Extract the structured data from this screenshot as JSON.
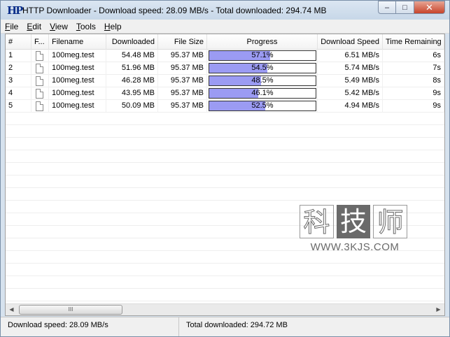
{
  "window": {
    "title": "HTTP Downloader - Download speed: 28.09 MB/s - Total downloaded: 294.74 MB",
    "icon": "HP",
    "buttons": {
      "minimize": "–",
      "maximize": "□",
      "close": "✕"
    }
  },
  "menu": [
    {
      "label": "File",
      "underline": "F",
      "rest": "ile"
    },
    {
      "label": "Edit",
      "underline": "E",
      "rest": "dit"
    },
    {
      "label": "View",
      "underline": "V",
      "rest": "iew"
    },
    {
      "label": "Tools",
      "underline": "T",
      "rest": "ools"
    },
    {
      "label": "Help",
      "underline": "H",
      "rest": "elp"
    }
  ],
  "columns": [
    "#",
    "F...",
    "Filename",
    "Downloaded",
    "File Size",
    "Progress",
    "Download Speed",
    "Time Remaining"
  ],
  "rows": [
    {
      "num": "1",
      "filename": "100meg.test",
      "downloaded": "54.48 MB",
      "size": "95.37 MB",
      "progress_label": "57.1%",
      "progress": 57.1,
      "speed": "6.51 MB/s",
      "remaining": "6s"
    },
    {
      "num": "2",
      "filename": "100meg.test",
      "downloaded": "51.96 MB",
      "size": "95.37 MB",
      "progress_label": "54.5%",
      "progress": 54.5,
      "speed": "5.74 MB/s",
      "remaining": "7s"
    },
    {
      "num": "3",
      "filename": "100meg.test",
      "downloaded": "46.28 MB",
      "size": "95.37 MB",
      "progress_label": "48.5%",
      "progress": 48.5,
      "speed": "5.49 MB/s",
      "remaining": "8s"
    },
    {
      "num": "4",
      "filename": "100meg.test",
      "downloaded": "43.95 MB",
      "size": "95.37 MB",
      "progress_label": "46.1%",
      "progress": 46.1,
      "speed": "5.42 MB/s",
      "remaining": "9s"
    },
    {
      "num": "5",
      "filename": "100meg.test",
      "downloaded": "50.09 MB",
      "size": "95.37 MB",
      "progress_label": "52.5%",
      "progress": 52.5,
      "speed": "4.94 MB/s",
      "remaining": "9s"
    }
  ],
  "scrollbar": {
    "left_arrow": "◀",
    "right_arrow": "▶",
    "grip": "III"
  },
  "status": {
    "speed": "Download speed: 28.09 MB/s",
    "total": "Total downloaded: 294.72 MB"
  },
  "watermark": {
    "chars": [
      "科",
      "技",
      "师"
    ],
    "url": "WWW.3KJS.COM"
  },
  "colors": {
    "progress_fill": "#9b9bf3",
    "title_gradient": "#c7d7e8"
  }
}
